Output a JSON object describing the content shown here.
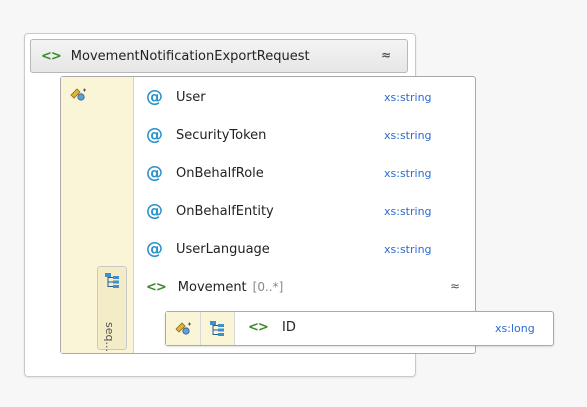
{
  "root": {
    "name": "MovementNotificationExportRequest",
    "collapse_glyph": "≈"
  },
  "attributes": [
    {
      "symbol": "@",
      "name": "User",
      "type": "xs:string"
    },
    {
      "symbol": "@",
      "name": "SecurityToken",
      "type": "xs:string"
    },
    {
      "symbol": "@",
      "name": "OnBehalfRole",
      "type": "xs:string"
    },
    {
      "symbol": "@",
      "name": "OnBehalfEntity",
      "type": "xs:string"
    },
    {
      "symbol": "@",
      "name": "UserLanguage",
      "type": "xs:string"
    }
  ],
  "movement": {
    "name": "Movement",
    "multiplicity": "[0..*]",
    "collapse_glyph": "≈"
  },
  "sequence": {
    "label": "seq..."
  },
  "child": {
    "name": "ID",
    "type": "xs:long"
  },
  "element_symbol": "<>",
  "colors": {
    "element": "#3a8a2a",
    "attribute": "#2a93c9",
    "type": "#2a6cd0",
    "compositor": "#fbf5d8"
  }
}
